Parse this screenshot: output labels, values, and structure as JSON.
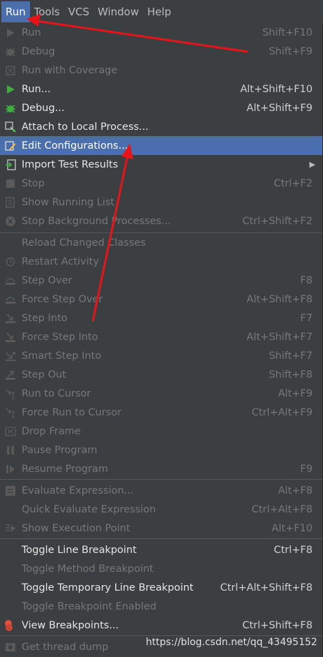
{
  "menubar": {
    "items": [
      {
        "label": "Run",
        "active": true
      },
      {
        "label": "Tools"
      },
      {
        "label": "VCS"
      },
      {
        "label": "Window"
      },
      {
        "label": "Help"
      }
    ]
  },
  "menu": {
    "items": [
      {
        "label": "Run",
        "shortcut": "Shift+F10",
        "state": "disabled",
        "icon": "play-icon"
      },
      {
        "label": "Debug",
        "shortcut": "Shift+F9",
        "state": "disabled",
        "icon": "bug-icon"
      },
      {
        "label": "Run with Coverage",
        "shortcut": "",
        "state": "disabled",
        "icon": "coverage-icon"
      },
      {
        "label": "Run...",
        "shortcut": "Alt+Shift+F10",
        "state": "enabled",
        "icon": "play-icon"
      },
      {
        "label": "Debug...",
        "shortcut": "Alt+Shift+F9",
        "state": "enabled",
        "icon": "bug-icon"
      },
      {
        "label": "Attach to Local Process...",
        "shortcut": "",
        "state": "enabled",
        "icon": "attach-icon"
      },
      {
        "label": "Edit Configurations...",
        "shortcut": "",
        "state": "selected",
        "icon": "edit-config-icon"
      },
      {
        "label": "Import Test Results",
        "shortcut": "",
        "state": "enabled",
        "icon": "import-icon",
        "submenu": true
      },
      {
        "label": "Stop",
        "shortcut": "Ctrl+F2",
        "state": "disabled",
        "icon": "stop-icon"
      },
      {
        "label": "Show Running List",
        "shortcut": "",
        "state": "disabled",
        "icon": "list-icon"
      },
      {
        "label": "Stop Background Processes...",
        "shortcut": "Ctrl+Shift+F2",
        "state": "disabled",
        "icon": "stop-bg-icon"
      },
      {
        "label": "Reload Changed Classes",
        "shortcut": "",
        "state": "disabled",
        "icon": ""
      },
      {
        "label": "Restart Activity",
        "shortcut": "",
        "state": "disabled",
        "icon": "restart-icon"
      },
      {
        "label": "Step Over",
        "shortcut": "F8",
        "state": "disabled",
        "icon": "step-over-icon"
      },
      {
        "label": "Force Step Over",
        "shortcut": "Alt+Shift+F8",
        "state": "disabled",
        "icon": "force-step-over-icon"
      },
      {
        "label": "Step Into",
        "shortcut": "F7",
        "state": "disabled",
        "icon": "step-into-icon"
      },
      {
        "label": "Force Step Into",
        "shortcut": "Alt+Shift+F7",
        "state": "disabled",
        "icon": "force-step-into-icon"
      },
      {
        "label": "Smart Step Into",
        "shortcut": "Shift+F7",
        "state": "disabled",
        "icon": "smart-step-into-icon"
      },
      {
        "label": "Step Out",
        "shortcut": "Shift+F8",
        "state": "disabled",
        "icon": "step-out-icon"
      },
      {
        "label": "Run to Cursor",
        "shortcut": "Alt+F9",
        "state": "disabled",
        "icon": "run-to-cursor-icon"
      },
      {
        "label": "Force Run to Cursor",
        "shortcut": "Ctrl+Alt+F9",
        "state": "disabled",
        "icon": "force-run-to-cursor-icon"
      },
      {
        "label": "Drop Frame",
        "shortcut": "",
        "state": "disabled",
        "icon": "drop-frame-icon"
      },
      {
        "label": "Pause Program",
        "shortcut": "",
        "state": "disabled",
        "icon": "pause-icon"
      },
      {
        "label": "Resume Program",
        "shortcut": "F9",
        "state": "disabled",
        "icon": "resume-icon"
      },
      {
        "label": "Evaluate Expression...",
        "shortcut": "Alt+F8",
        "state": "disabled",
        "icon": "evaluate-icon"
      },
      {
        "label": "Quick Evaluate Expression",
        "shortcut": "Ctrl+Alt+F8",
        "state": "disabled",
        "icon": ""
      },
      {
        "label": "Show Execution Point",
        "shortcut": "Alt+F10",
        "state": "disabled",
        "icon": "execution-point-icon"
      },
      {
        "label": "Toggle Line Breakpoint",
        "shortcut": "Ctrl+F8",
        "state": "enabled",
        "icon": ""
      },
      {
        "label": "Toggle Method Breakpoint",
        "shortcut": "",
        "state": "disabled",
        "icon": ""
      },
      {
        "label": "Toggle Temporary Line Breakpoint",
        "shortcut": "Ctrl+Alt+Shift+F8",
        "state": "enabled",
        "icon": ""
      },
      {
        "label": "Toggle Breakpoint Enabled",
        "shortcut": "",
        "state": "disabled",
        "icon": ""
      },
      {
        "label": "View Breakpoints...",
        "shortcut": "Ctrl+Shift+F8",
        "state": "enabled",
        "icon": "breakpoints-icon"
      },
      {
        "label": "Get thread dump",
        "shortcut": "",
        "state": "disabled",
        "icon": "thread-dump-icon"
      }
    ]
  },
  "watermark": "https://blog.csdn.net/qq_43495152",
  "colors": {
    "background": "#3c3f41",
    "selection": "#4b6eaf",
    "annotation_arrow": "#e8141a"
  }
}
